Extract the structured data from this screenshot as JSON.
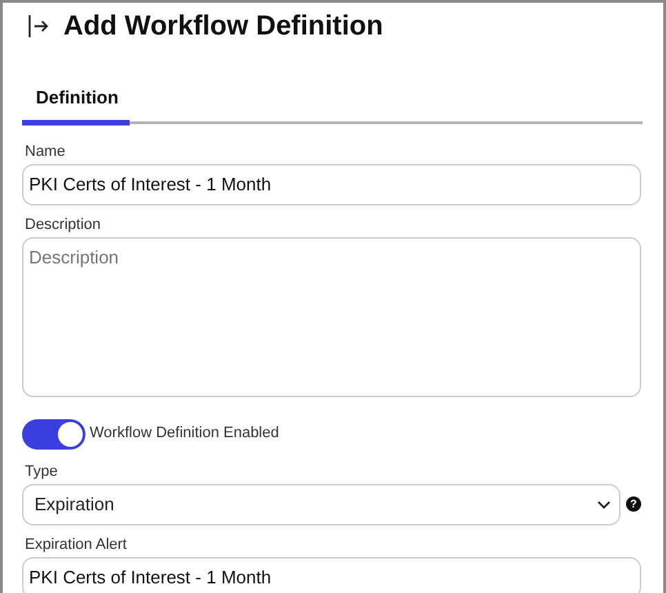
{
  "title": "Add Workflow Definition",
  "tabs": [
    {
      "label": "Definition",
      "selected": true
    }
  ],
  "fields": [
    {
      "kind": "text",
      "label": "Name",
      "value": "PKI Certs of Interest - 1 Month"
    },
    {
      "kind": "textarea",
      "label": "Description",
      "placeholder": "Description"
    },
    {
      "kind": "switch",
      "label": "Workflow Definition Enabled",
      "on": true
    },
    {
      "kind": "select",
      "label": "Type",
      "value": "Expiration",
      "help": "?"
    },
    {
      "kind": "text",
      "label": "Expiration Alert",
      "value": "PKI Certs of Interest - 1 Month"
    }
  ]
}
